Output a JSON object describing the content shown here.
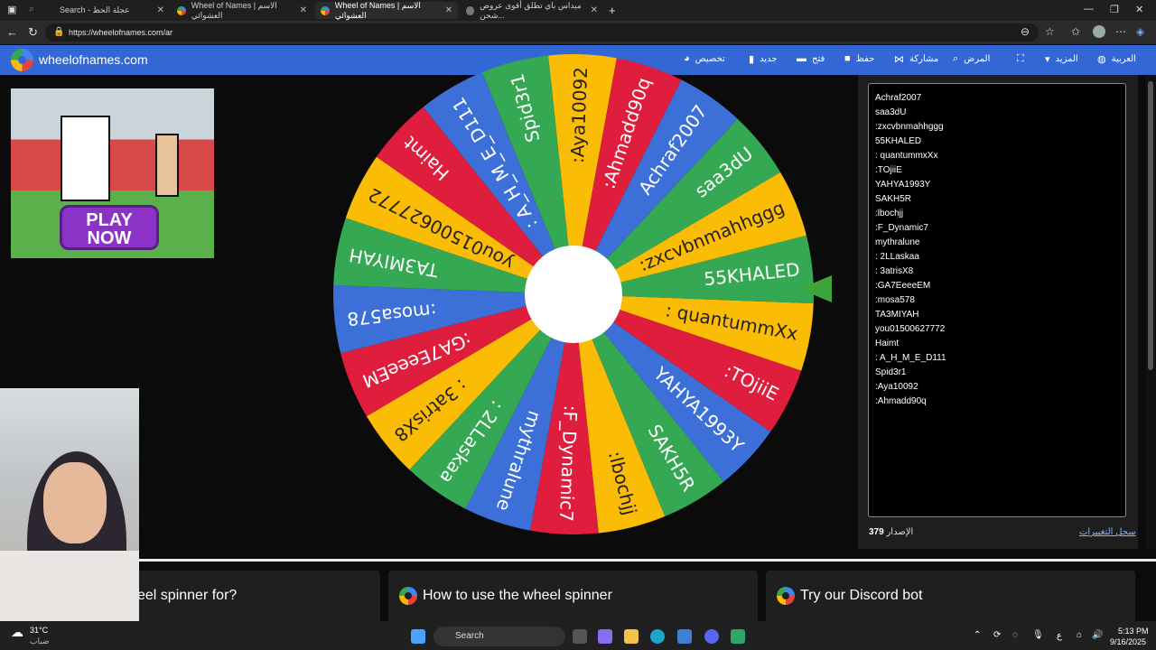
{
  "browser": {
    "tabs": [
      {
        "label": "Search - عجلة الحظ"
      },
      {
        "label": "Wheel of Names | الاسم العشوائي"
      },
      {
        "label": "Wheel of Names | الاسم العشوائي"
      },
      {
        "label": "ميداس باي تطلق أقوى عروض شحن..."
      }
    ],
    "url": "https://wheelofnames.com/ar"
  },
  "header": {
    "brand": "wheelofnames.com",
    "menu": [
      {
        "label": "تخصيص",
        "icon": "palette-icon"
      },
      {
        "label": "جديد",
        "icon": "file-icon"
      },
      {
        "label": "فتح",
        "icon": "folder-icon"
      },
      {
        "label": "حفظ",
        "icon": "save-icon"
      },
      {
        "label": "مشاركة",
        "icon": "share-icon"
      },
      {
        "label": "المرض",
        "icon": "search-icon"
      },
      {
        "label": "",
        "icon": "fullscreen-icon"
      },
      {
        "label": "المزيد",
        "icon": "chevron-down-icon"
      },
      {
        "label": "العربية",
        "icon": "globe-icon"
      }
    ]
  },
  "ad": {
    "play_label": "PLAY NOW"
  },
  "wheel": {
    "colors": [
      "#34a853",
      "#fbbc05",
      "#de1e3c",
      "#3c6fd8"
    ],
    "segments": [
      "55KHALED",
      ": quantummXx",
      ":TOjiiE",
      "YAHYA1993Y",
      "SAKH5R",
      ":lbochjj",
      ":F_Dynamic7",
      "mythralune",
      ": 2LLaskaa",
      ": 3atrisX8",
      ":GA7EeeeEM",
      ":mosa578",
      "TA3MIYAH",
      "you01500627772",
      "Haimt",
      ": A_H_M_E_D111",
      "Spid3r1",
      ":Aya10092",
      ":Ahmadd90q",
      "Achraf2007",
      "saa3dU",
      ":zxcvbnmahhggg"
    ]
  },
  "entries": {
    "items": [
      "Achraf2007",
      "saa3dU",
      ":zxcvbnmahhggg",
      "55KHALED",
      ": quantummxXx",
      ":TOjiiE",
      "YAHYA1993Y",
      "SAKH5R",
      ":lbochjj",
      ":F_Dynamic7",
      "mythralune",
      ": 2LLaskaa",
      ": 3atrisX8",
      ":GA7EeeeEM",
      ":mosa578",
      "TA3MIYAH",
      "you01500627772",
      "Haimt",
      ": A_H_M_E_D111",
      "Spid3r1",
      ":Aya10092",
      ":Ahmadd90q"
    ],
    "version_label": "الإصدار",
    "version_number": "379",
    "changelog": "سجل التغييرات"
  },
  "cards": [
    {
      "title": "eel spinner for?"
    },
    {
      "title": "How to use the wheel spinner"
    },
    {
      "title": "Try our Discord bot"
    }
  ],
  "taskbar": {
    "weather_temp": "31°C",
    "weather_desc": "ضباب",
    "search": "Search",
    "lang": "ع",
    "time": "5:13 PM",
    "date": "9/16/2025"
  }
}
